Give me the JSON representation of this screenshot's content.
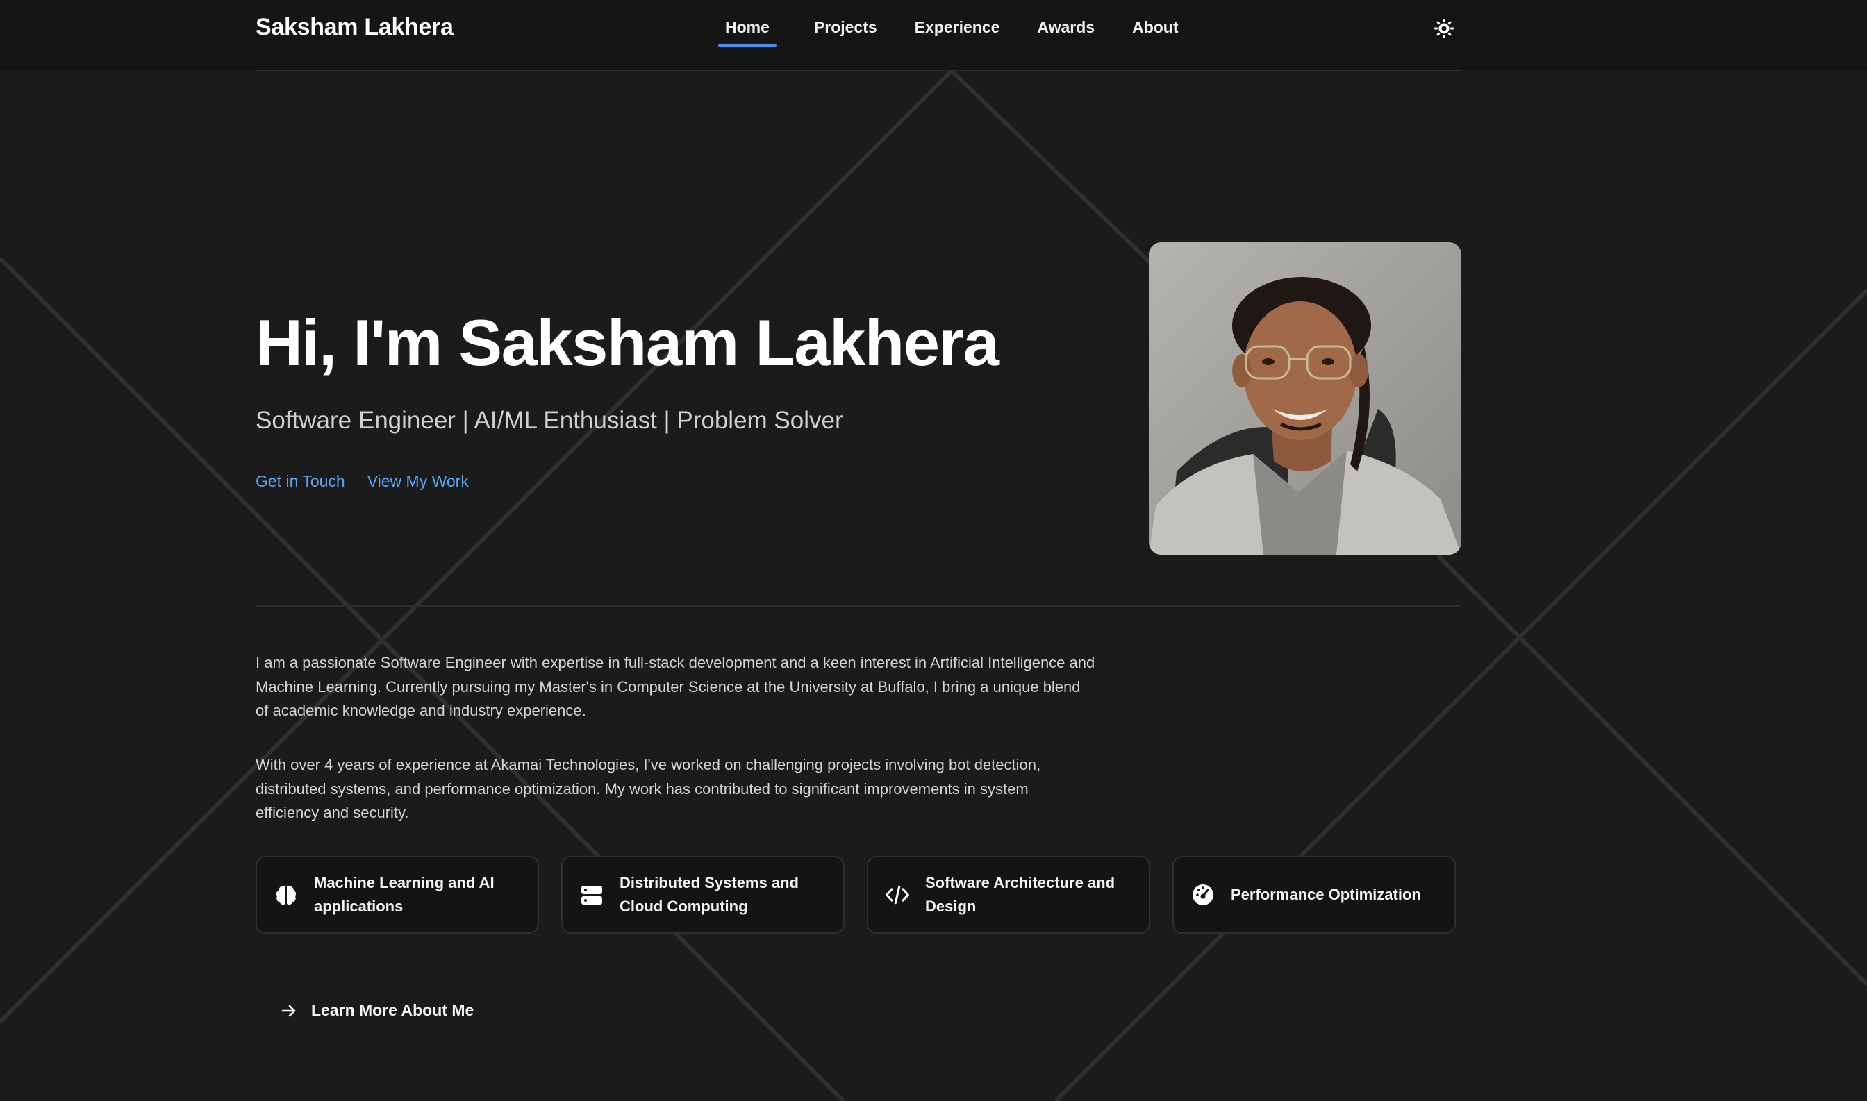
{
  "nav": {
    "brand": "Saksham Lakhera",
    "links": [
      {
        "label": "Home",
        "active": true
      },
      {
        "label": "Projects",
        "active": false
      },
      {
        "label": "Experience",
        "active": false
      },
      {
        "label": "Awards",
        "active": false
      },
      {
        "label": "About",
        "active": false
      }
    ],
    "theme_toggle_icon": "sun-icon",
    "accent_color": "#4a8ef0"
  },
  "hero": {
    "title": "Hi, I'm Saksham Lakhera",
    "subtitle": "Software Engineer | AI/ML Enthusiast | Problem Solver",
    "cta_primary": "Get in Touch",
    "cta_secondary": "View My Work",
    "link_color": "#5ba6f5"
  },
  "about": {
    "paragraph_1": "I am a passionate Software Engineer with expertise in full-stack development and a keen interest in Artificial Intelligence and Machine Learning. Currently pursuing my Master's in Computer Science at the University at Buffalo, I bring a unique blend of academic knowledge and industry experience.",
    "paragraph_2": "With over 4 years of experience at Akamai Technologies, I've worked on challenging projects involving bot detection, distributed systems, and performance optimization. My work has contributed to significant improvements in system efficiency and security.",
    "skills": [
      {
        "label": "Machine Learning and AI applications",
        "icon": "brain-icon"
      },
      {
        "label": "Distributed Systems and Cloud Computing",
        "icon": "server-icon"
      },
      {
        "label": "Software Architecture and Design",
        "icon": "code-icon"
      },
      {
        "label": "Performance Optimization",
        "icon": "gauge-icon"
      }
    ],
    "learn_more": "Learn More About Me",
    "learn_more_icon": "arrow-right-icon"
  },
  "colors": {
    "background": "#1b1b1b",
    "nav_background": "#151515",
    "card_background": "#141414"
  }
}
